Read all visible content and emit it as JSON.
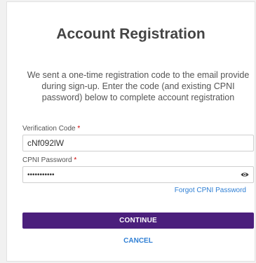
{
  "page": {
    "title": "Account Registration",
    "intro_lines": [
      "We sent a one-time registration code to the email provide",
      "during sign-up. Enter the code (and existing CPNI",
      "password) below to complete account registration"
    ]
  },
  "form": {
    "verification": {
      "label": "Verification Code",
      "required_mark": "*",
      "value": "cNf092lW"
    },
    "cpni_password": {
      "label": "CPNI Password",
      "required_mark": "*",
      "value": "•••••••••••",
      "icon": "eye-icon"
    },
    "forgot_link": "Forgot CPNI Password"
  },
  "actions": {
    "continue_label": "CONTINUE",
    "cancel_label": "CANCEL"
  },
  "colors": {
    "primary": "#4b1f7c",
    "link": "#2f7fd4",
    "required": "#d00000"
  }
}
